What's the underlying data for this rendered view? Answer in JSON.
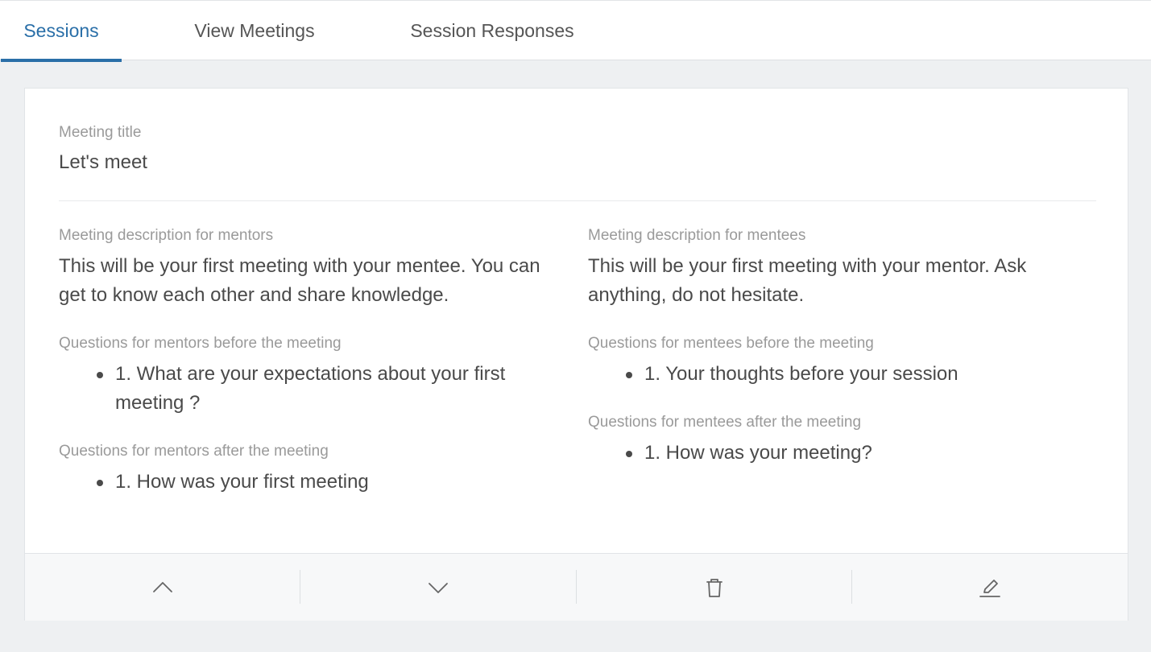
{
  "tabs": [
    {
      "label": "Sessions",
      "active": true
    },
    {
      "label": "View Meetings",
      "active": false
    },
    {
      "label": "Session Responses",
      "active": false
    }
  ],
  "meeting": {
    "title_label": "Meeting title",
    "title_value": "Let's meet",
    "mentors": {
      "description_label": "Meeting description for mentors",
      "description": "This will be your first meeting with your mentee. You can get to know each other and share knowledge.",
      "before_label": "Questions for mentors before the meeting",
      "before_questions": [
        "1. What are your expectations about your first meeting ?"
      ],
      "after_label": "Questions for mentors after the meeting",
      "after_questions": [
        "1. How was your first meeting"
      ]
    },
    "mentees": {
      "description_label": "Meeting description for mentees",
      "description": "This will be your first meeting with your mentor. Ask anything, do not hesitate.",
      "before_label": "Questions for mentees before the meeting",
      "before_questions": [
        "1. Your thoughts before your session"
      ],
      "after_label": "Questions for mentees after the meeting",
      "after_questions": [
        "1. How was your meeting?"
      ]
    }
  },
  "actions": [
    {
      "icon": "chevron-up-icon"
    },
    {
      "icon": "chevron-down-icon"
    },
    {
      "icon": "trash-icon"
    },
    {
      "icon": "pencil-icon"
    }
  ],
  "colors": {
    "accent": "#2a6fa8",
    "background": "#eef0f2",
    "text": "#4a4a4a",
    "label": "#9a9a9a"
  }
}
